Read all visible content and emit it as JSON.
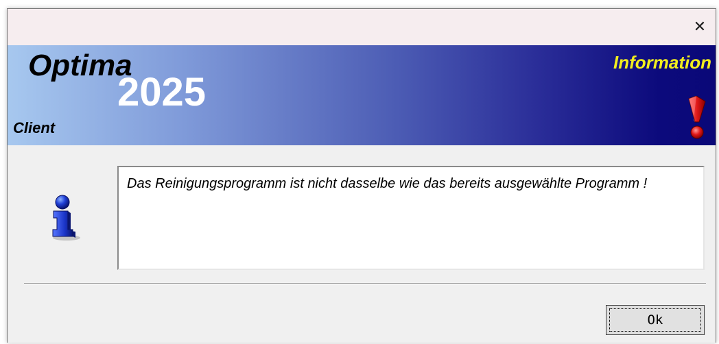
{
  "window": {
    "close_glyph": "✕"
  },
  "banner": {
    "brand_name": "Optima",
    "brand_year": "2025",
    "brand_edition": "Client",
    "dialog_type": "Information"
  },
  "message": {
    "text": "Das Reinigungsprogramm ist nicht dasselbe wie das bereits ausgewählte Programm !"
  },
  "buttons": {
    "ok_label": "Ok"
  },
  "icons": {
    "close": "close-icon",
    "exclamation": "exclamation-icon",
    "info": "info-icon"
  },
  "colors": {
    "banner_left": "#a7c8ef",
    "banner_right": "#0a0878",
    "dialog_type_text": "#f2ee1e",
    "titlebar": "#f6edef"
  }
}
